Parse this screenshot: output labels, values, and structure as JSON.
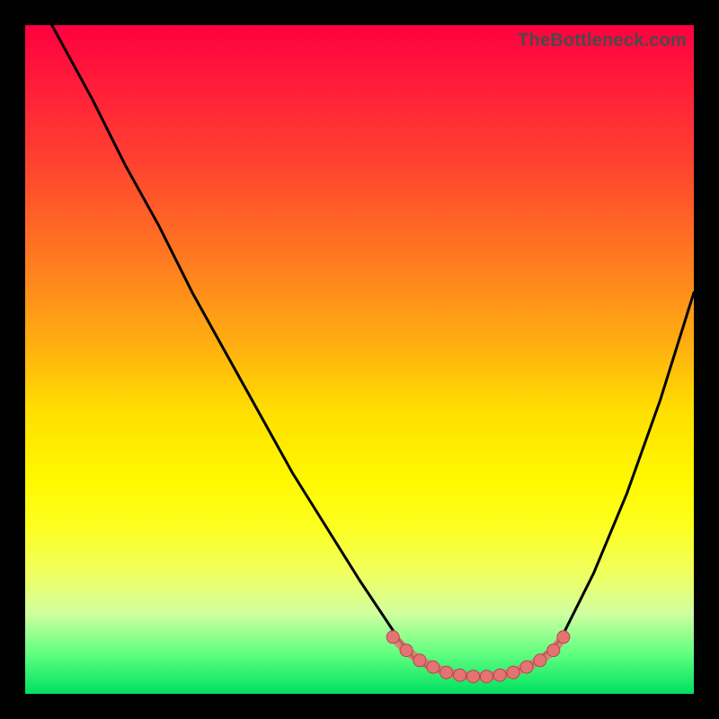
{
  "attribution": "TheBottleneck.com",
  "colors": {
    "curve": "#000000",
    "dots": "#e57373",
    "dot_outline": "#b34a4a"
  },
  "chart_data": {
    "type": "line",
    "title": "",
    "xlabel": "",
    "ylabel": "",
    "xlim": [
      0,
      100
    ],
    "ylim": [
      0,
      100
    ],
    "series": [
      {
        "name": "bottleneck-curve",
        "x": [
          4,
          10,
          15,
          20,
          25,
          30,
          35,
          40,
          45,
          50,
          54,
          56,
          58,
          60,
          63,
          66,
          69,
          72,
          76,
          80,
          82,
          85,
          90,
          95,
          100
        ],
        "values": [
          100,
          89,
          79,
          70,
          60,
          51,
          42,
          33,
          25,
          17,
          11,
          8,
          5.5,
          4,
          3,
          2.5,
          2.5,
          3,
          4.5,
          8,
          12,
          18,
          30,
          44,
          60
        ]
      }
    ],
    "optimal_region": {
      "name": "dotted-minimum",
      "x": [
        55,
        57,
        59,
        61,
        63,
        65,
        67,
        69,
        71,
        73,
        75,
        77,
        79,
        80.5
      ],
      "values": [
        8.5,
        6.5,
        5,
        4,
        3.2,
        2.8,
        2.6,
        2.6,
        2.8,
        3.2,
        4,
        5,
        6.5,
        8.5
      ]
    }
  }
}
